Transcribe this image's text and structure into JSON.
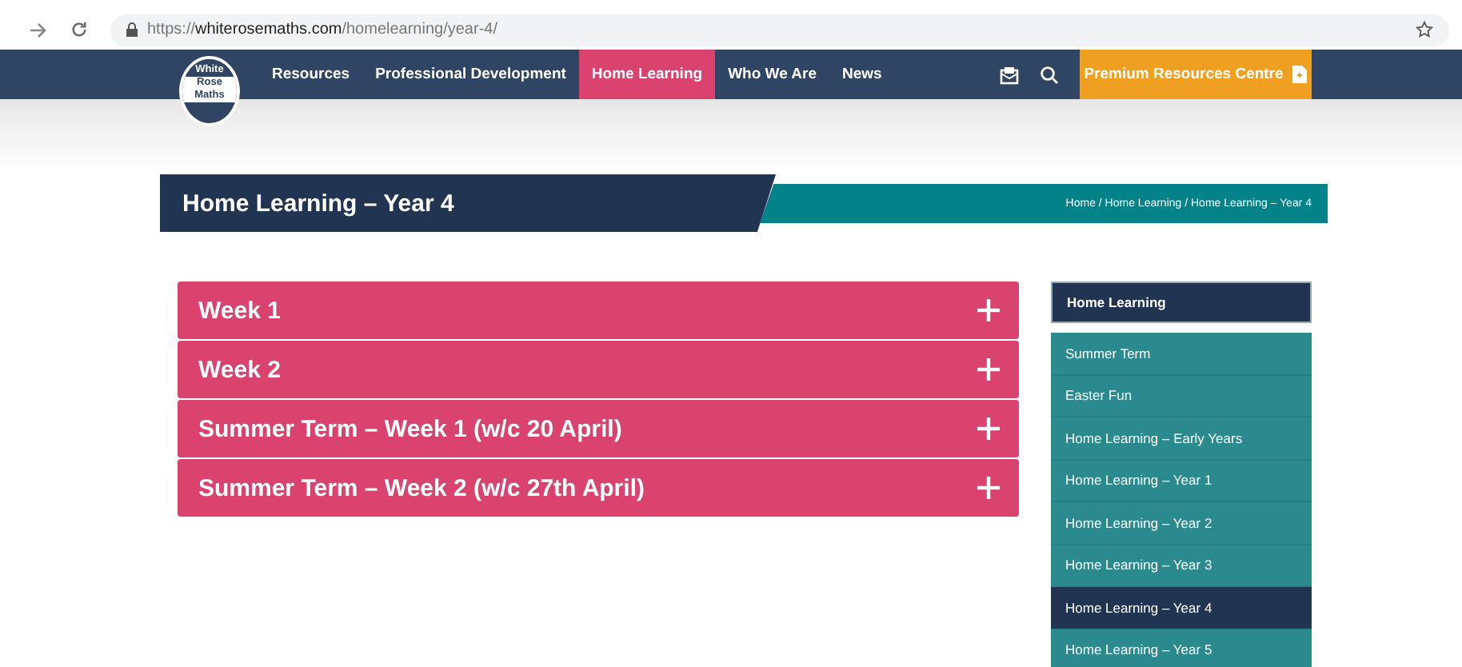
{
  "browser": {
    "url": "https://**whiterosemaths.com**/homelearning/year-4/"
  },
  "nav": {
    "logo": [
      "White",
      "Rose",
      "Maths"
    ],
    "items": [
      {
        "label": "Resources",
        "selected": false
      },
      {
        "label": "Professional Development",
        "selected": false
      },
      {
        "label": "Home Learning",
        "selected": true
      },
      {
        "label": "Who We Are",
        "selected": false
      },
      {
        "label": "News",
        "selected": false
      }
    ],
    "premium_button": "Premium Resources Centre"
  },
  "page_title": "Home Learning – Year 4",
  "breadcrumb": "Home / Home Learning / Home Learning – Year 4",
  "accordion": [
    {
      "label": "Week 1",
      "expanded": false
    },
    {
      "label": "Week 2",
      "expanded": false
    },
    {
      "label": "Summer Term – Week 1 (w/c 20 April)",
      "expanded": false
    },
    {
      "label": "Summer Term – Week 2 (w/c 27th April)",
      "expanded": false
    }
  ],
  "sidebar": {
    "heading": "Home Learning",
    "items": [
      {
        "label": "Summer Term",
        "selected": false
      },
      {
        "label": "Easter Fun",
        "selected": false
      },
      {
        "label": "Home Learning – Early Years",
        "selected": false
      },
      {
        "label": "Home Learning – Year 1",
        "selected": false
      },
      {
        "label": "Home Learning – Year 2",
        "selected": false
      },
      {
        "label": "Home Learning – Year 3",
        "selected": false
      },
      {
        "label": "Home Learning – Year 4",
        "selected": true
      },
      {
        "label": "Home Learning – Year 5",
        "selected": false
      }
    ]
  }
}
